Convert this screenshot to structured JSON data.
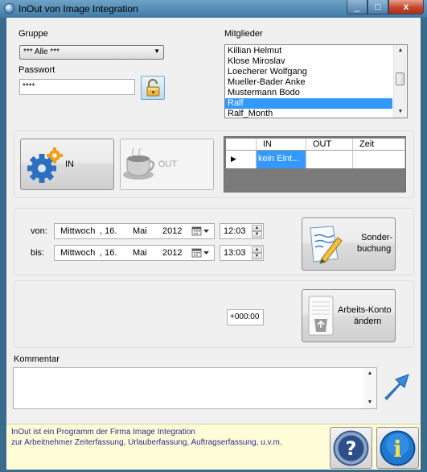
{
  "window": {
    "title": "InOut von Image Integration",
    "min_label": "_",
    "max_label": "□",
    "close_label": "x"
  },
  "gruppe": {
    "label": "Gruppe",
    "value": "*** Alle ***"
  },
  "passwort": {
    "label": "Passwort",
    "value": "****"
  },
  "mitglieder": {
    "label": "Mitglieder",
    "items": [
      "Killian Helmut",
      "Klose Miroslav",
      "Loecherer Wolfgang",
      "Mueller-Bader Anke",
      "Mustermann Bodo",
      "Ralf",
      "Ralf_Month"
    ],
    "selected_index": 5
  },
  "in_button": {
    "label": "IN"
  },
  "out_button": {
    "label": "OUT"
  },
  "grid": {
    "columns": [
      "IN",
      "OUT",
      "Zeit"
    ],
    "row": {
      "in": "kein Eint...",
      "out": "",
      "zeit": ""
    },
    "row_marker": "▶"
  },
  "von": {
    "label": "von:",
    "weekday": "Mittwoch",
    "day": ", 16.",
    "month": "Mai",
    "year": "2012",
    "time": "12:03"
  },
  "bis": {
    "label": "bis:",
    "weekday": "Mittwoch",
    "day": ", 16.",
    "month": "Mai",
    "year": "2012",
    "time": "13:03"
  },
  "sonderbuchung": {
    "line1": "Sonder-",
    "line2": "buchung"
  },
  "konto": {
    "value": "+000:00",
    "line1": "Arbeits-Konto",
    "line2": "ändern"
  },
  "kommentar": {
    "label": "Kommentar",
    "value": ""
  },
  "info": {
    "line1": "InOut ist ein Programm der Firma Image Integration",
    "line2": "zur Arbeitnehmer Zeiterfassung, Urlauberfassung, Auftragserfassung, u.v.m."
  },
  "colors": {
    "selection": "#3399ff",
    "info_background": "#fffcd8",
    "info_text": "#2c2c8c",
    "title_bar": "#4f86b0"
  },
  "icons": {
    "in": "gear-icon",
    "out": "coffee-cup-icon",
    "lock": "padlock-icon",
    "sonder": "note-pencil-icon",
    "konto": "document-recycle-icon",
    "help": "question-icon",
    "about": "info-icon",
    "send": "arrow-icon",
    "calendar": "calendar-icon"
  }
}
